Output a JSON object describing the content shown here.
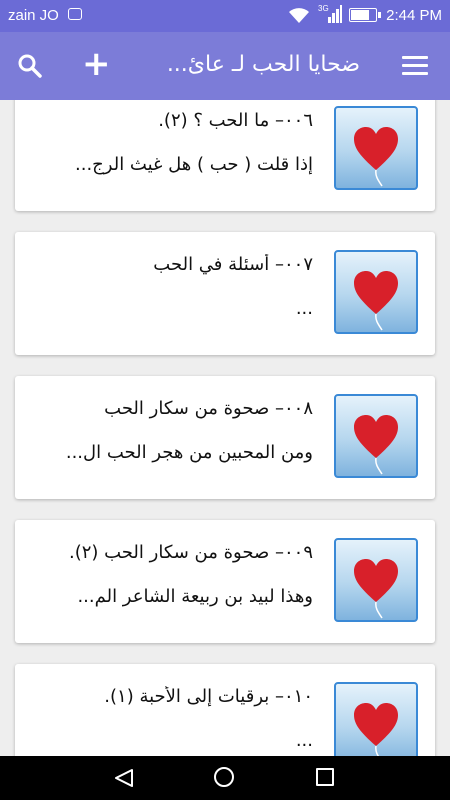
{
  "status_bar": {
    "carrier": "zain JO",
    "network": "3G",
    "time": "2:44 PM"
  },
  "app_bar": {
    "title": "ضحايا الحب لـ عائ..."
  },
  "items": [
    {
      "title": "٠٠٦– ما الحب ؟ (٢).",
      "subtitle": "إذا قلت ( حب ) هل غيث الرج..."
    },
    {
      "title": "٠٠٧– أسئلة في الحب",
      "subtitle": "..."
    },
    {
      "title": "٠٠٨– صحوة من سكار الحب",
      "subtitle": "ومن المحبين من هجر الحب ال..."
    },
    {
      "title": "٠٠٩– صحوة من سكار الحب (٢).",
      "subtitle": "وهذا لبيد بن ربيعة الشاعر الم..."
    },
    {
      "title": "٠١٠– برقيات إلى الأحبة (١).",
      "subtitle": "..."
    }
  ],
  "colors": {
    "app_bar": "#7c7cd8",
    "status_bar": "#6b6bd6",
    "thumb_border": "#3a89d6",
    "heart": "#d8202a"
  },
  "icons": {
    "menu": "hamburger-icon",
    "add": "plus-icon",
    "search": "search-icon"
  }
}
